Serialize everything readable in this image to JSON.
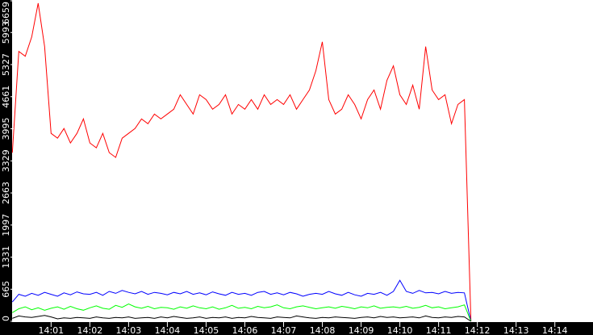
{
  "chart_data": {
    "type": "line",
    "title": "",
    "xlabel": "",
    "ylabel": "",
    "x_start": "14:00:00",
    "interval_seconds": 10,
    "xlim_minutes": [
      0,
      14.9
    ],
    "ylim": [
      0,
      6659
    ],
    "y_ticks": [
      "0",
      "665",
      "1331",
      "1997",
      "2663",
      "3329",
      "3995",
      "4661",
      "5327",
      "5993",
      "6659"
    ],
    "x_ticks": [
      "14:01",
      "14:02",
      "14:03",
      "14:04",
      "14:05",
      "14:06",
      "14:07",
      "14:08",
      "14:09",
      "14:10",
      "14:11",
      "14:12",
      "14:13",
      "14:14"
    ],
    "grid": false,
    "series": [
      {
        "name": "red",
        "color": "#ff0000",
        "values": [
          3500,
          5600,
          5500,
          5900,
          6600,
          5700,
          3900,
          3800,
          4000,
          3700,
          3900,
          4200,
          3700,
          3600,
          3900,
          3500,
          3400,
          3800,
          3900,
          4000,
          4200,
          4100,
          4300,
          4200,
          4300,
          4400,
          4700,
          4500,
          4300,
          4700,
          4600,
          4400,
          4500,
          4700,
          4300,
          4500,
          4400,
          4600,
          4400,
          4700,
          4500,
          4600,
          4500,
          4700,
          4400,
          4600,
          4800,
          5200,
          5800,
          4600,
          4300,
          4400,
          4700,
          4500,
          4200,
          4600,
          4800,
          4400,
          5000,
          5300,
          4700,
          4500,
          4900,
          4400,
          5700,
          4800,
          4600,
          4700,
          4100,
          4500,
          4600,
          0
        ]
      },
      {
        "name": "blue",
        "color": "#0000ff",
        "values": [
          400,
          560,
          520,
          580,
          540,
          600,
          560,
          520,
          590,
          550,
          610,
          570,
          560,
          600,
          540,
          620,
          580,
          640,
          600,
          570,
          620,
          560,
          600,
          580,
          550,
          600,
          570,
          620,
          560,
          590,
          550,
          610,
          570,
          540,
          600,
          560,
          580,
          540,
          600,
          620,
          560,
          590,
          550,
          600,
          570,
          520,
          560,
          580,
          560,
          620,
          570,
          540,
          600,
          550,
          520,
          580,
          560,
          600,
          540,
          620,
          850,
          620,
          580,
          640,
          590,
          600,
          570,
          620,
          580,
          600,
          590,
          0
        ]
      },
      {
        "name": "green",
        "color": "#00ff00",
        "values": [
          180,
          260,
          300,
          240,
          280,
          230,
          270,
          300,
          250,
          310,
          260,
          230,
          280,
          320,
          270,
          250,
          330,
          290,
          360,
          300,
          270,
          310,
          260,
          290,
          280,
          250,
          300,
          270,
          320,
          280,
          260,
          300,
          250,
          280,
          330,
          270,
          290,
          260,
          310,
          280,
          300,
          340,
          280,
          260,
          300,
          320,
          290,
          260,
          280,
          300,
          270,
          310,
          290,
          260,
          300,
          280,
          320,
          270,
          290,
          300,
          280,
          310,
          270,
          290,
          330,
          280,
          300,
          260,
          280,
          300,
          340,
          0
        ]
      },
      {
        "name": "black",
        "color": "#000000",
        "values": [
          60,
          110,
          90,
          80,
          100,
          120,
          90,
          50,
          70,
          60,
          80,
          70,
          60,
          90,
          70,
          60,
          80,
          70,
          90,
          60,
          70,
          80,
          60,
          90,
          70,
          100,
          80,
          60,
          70,
          90,
          60,
          80,
          70,
          90,
          60,
          80,
          70,
          100,
          80,
          70,
          60,
          90,
          80,
          70,
          110,
          90,
          70,
          60,
          80,
          70,
          90,
          80,
          70,
          60,
          80,
          90,
          70,
          100,
          80,
          90,
          70,
          80,
          90,
          70,
          110,
          80,
          70,
          90,
          80,
          100,
          90,
          0
        ]
      }
    ]
  }
}
